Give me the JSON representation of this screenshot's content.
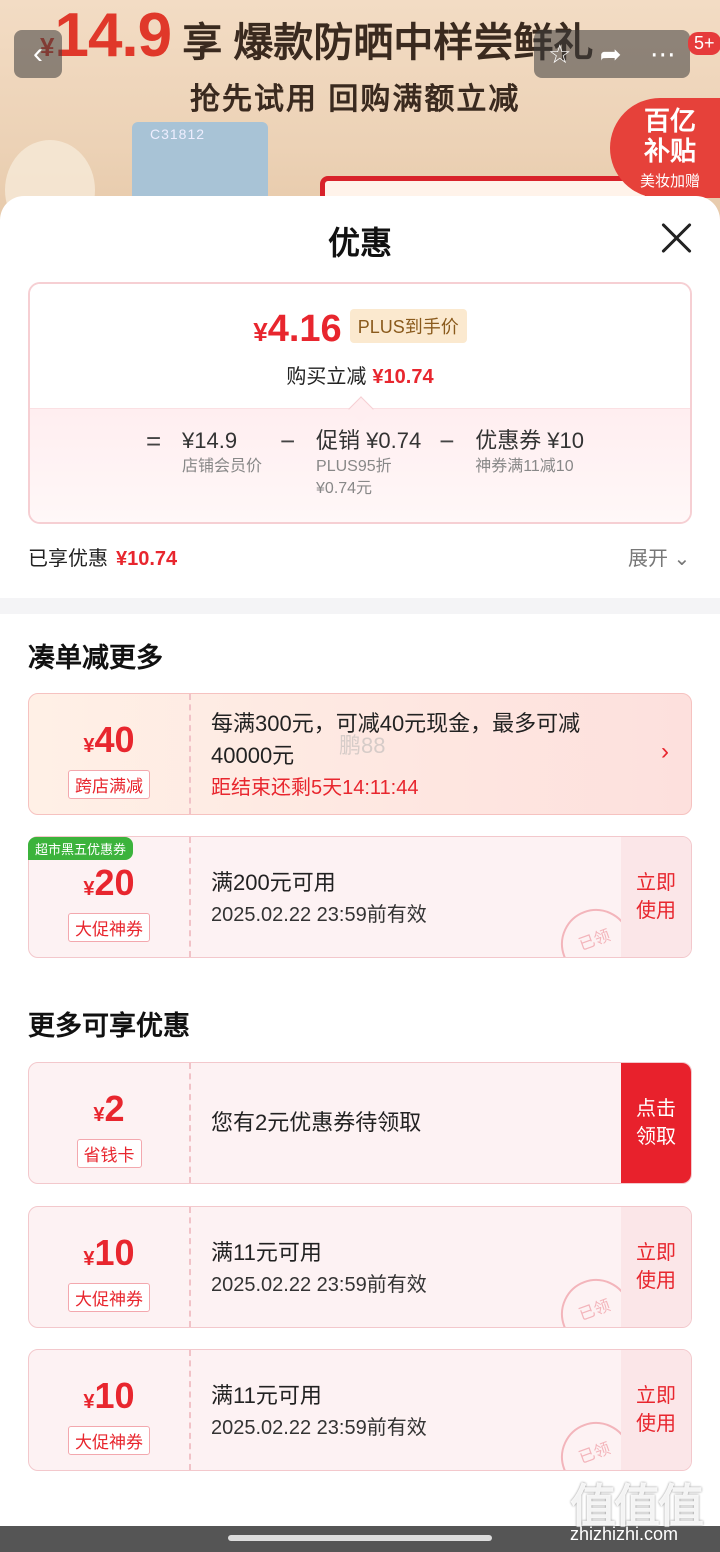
{
  "banner": {
    "yen": "¥",
    "price": "14.9",
    "headline": "享 爆款防晒中样尝鲜礼",
    "subline": "抢先试用  回购满额立减",
    "product_code": "C31812",
    "subsidy_main": "百亿\n补贴",
    "subsidy_sub": "美妆加赠",
    "badge": "5+"
  },
  "sheet": {
    "title": "优惠",
    "close_icon": "close-icon"
  },
  "price_card": {
    "yen": "¥",
    "final_price": "4.16",
    "plus_tag": "PLUS到手价",
    "instant_label": "购买立减",
    "instant_amount": "¥10.74",
    "breakdown": [
      {
        "op": "=",
        "main": "¥14.9",
        "sub1": "店铺会员价",
        "sub2": ""
      },
      {
        "op": "−",
        "main": "促销 ¥0.74",
        "sub1": "PLUS95折",
        "sub2": "¥0.74元"
      },
      {
        "op": "−",
        "main": "优惠券 ¥10",
        "sub1": "神券满11减10",
        "sub2": ""
      }
    ]
  },
  "summary": {
    "enjoyed_label": "已享优惠",
    "enjoyed_amount": "¥10.74",
    "expand_label": "展开 ⌄"
  },
  "section_more_orders": {
    "title": "凑单减更多"
  },
  "promo": {
    "yen": "¥",
    "amount": "40",
    "tag": "跨店满减",
    "desc": "每满300元，可减40元现金，最多可减40000元",
    "countdown": "距结束还剩5天14:11:44",
    "watermark": "鹏88"
  },
  "coupon_market": {
    "ribbon": "超市黑五优惠券",
    "yen": "¥",
    "amount": "20",
    "tag": "大促神券",
    "line1": "满200元可用",
    "line2": "2025.02.22 23:59前有效",
    "action": "立即\n使用",
    "stamp": "已领"
  },
  "section_more_benefits": {
    "title": "更多可享优惠"
  },
  "coupon_saver": {
    "yen": "¥",
    "amount": "2",
    "tag": "省钱卡",
    "line1": "您有2元优惠券待领取",
    "action": "点击\n领取"
  },
  "coupon_a": {
    "yen": "¥",
    "amount": "10",
    "tag": "大促神券",
    "line1": "满11元可用",
    "line2": "2025.02.22 23:59前有效",
    "action": "立即\n使用",
    "stamp": "已领"
  },
  "coupon_b": {
    "yen": "¥",
    "amount": "10",
    "tag": "大促神券",
    "line1": "满11元可用",
    "line2": "2025.02.22 23:59前有效",
    "action": "立即\n使用",
    "stamp": "已领"
  },
  "footer": {
    "site_logo": "值值值",
    "site_url": "zhizhizhi.com"
  },
  "colors": {
    "accent": "#e8262e",
    "plus": "#8a5a1c",
    "ribbon": "#3cb33c"
  }
}
